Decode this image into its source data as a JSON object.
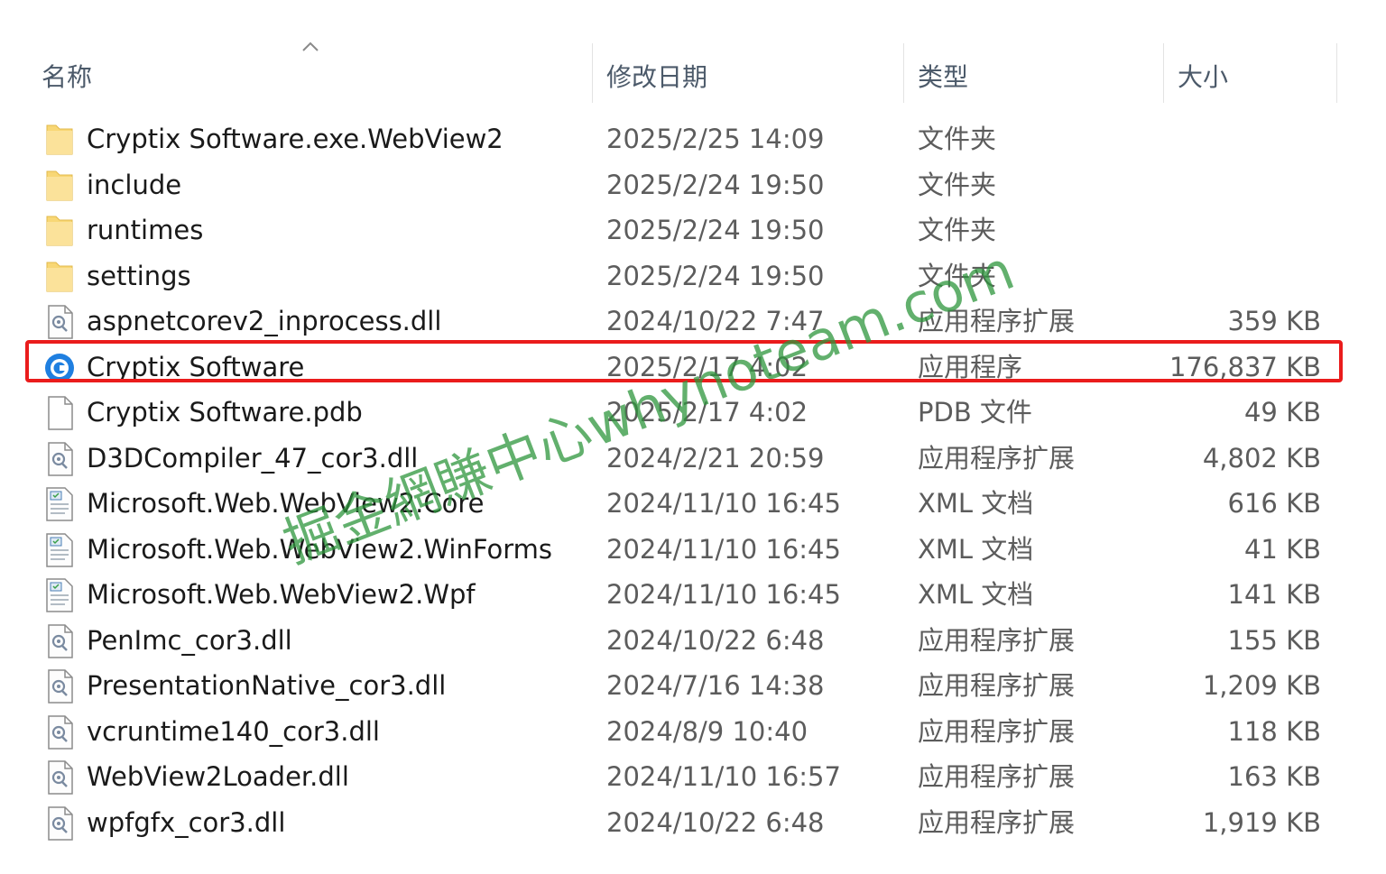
{
  "header": {
    "col_name": "名称",
    "col_date": "修改日期",
    "col_type": "类型",
    "col_size": "大小"
  },
  "files": [
    {
      "name": "Cryptix Software.exe.WebView2",
      "date": "2025/2/25 14:09",
      "type": "文件夹",
      "size": "",
      "icon": "folder-icon"
    },
    {
      "name": "include",
      "date": "2025/2/24 19:50",
      "type": "文件夹",
      "size": "",
      "icon": "folder-icon"
    },
    {
      "name": "runtimes",
      "date": "2025/2/24 19:50",
      "type": "文件夹",
      "size": "",
      "icon": "folder-icon"
    },
    {
      "name": "settings",
      "date": "2025/2/24 19:50",
      "type": "文件夹",
      "size": "",
      "icon": "folder-icon"
    },
    {
      "name": "aspnetcorev2_inprocess.dll",
      "date": "2024/10/22 7:47",
      "type": "应用程序扩展",
      "size": "359 KB",
      "icon": "dll-file-icon"
    },
    {
      "name": "Cryptix Software",
      "date": "2025/2/17 4:02",
      "type": "应用程序",
      "size": "176,837 KB",
      "icon": "app-icon"
    },
    {
      "name": "Cryptix Software.pdb",
      "date": "2025/2/17 4:02",
      "type": "PDB 文件",
      "size": "49 KB",
      "icon": "blank-file-icon"
    },
    {
      "name": "D3DCompiler_47_cor3.dll",
      "date": "2024/2/21 20:59",
      "type": "应用程序扩展",
      "size": "4,802 KB",
      "icon": "dll-file-icon"
    },
    {
      "name": "Microsoft.Web.WebView2.Core",
      "date": "2024/11/10 16:45",
      "type": "XML 文档",
      "size": "616 KB",
      "icon": "xml-file-icon"
    },
    {
      "name": "Microsoft.Web.WebView2.WinForms",
      "date": "2024/11/10 16:45",
      "type": "XML 文档",
      "size": "41 KB",
      "icon": "xml-file-icon"
    },
    {
      "name": "Microsoft.Web.WebView2.Wpf",
      "date": "2024/11/10 16:45",
      "type": "XML 文档",
      "size": "141 KB",
      "icon": "xml-file-icon"
    },
    {
      "name": "PenImc_cor3.dll",
      "date": "2024/10/22 6:48",
      "type": "应用程序扩展",
      "size": "155 KB",
      "icon": "dll-file-icon"
    },
    {
      "name": "PresentationNative_cor3.dll",
      "date": "2024/7/16 14:38",
      "type": "应用程序扩展",
      "size": "1,209 KB",
      "icon": "dll-file-icon"
    },
    {
      "name": "vcruntime140_cor3.dll",
      "date": "2024/8/9 10:40",
      "type": "应用程序扩展",
      "size": "118 KB",
      "icon": "dll-file-icon"
    },
    {
      "name": "WebView2Loader.dll",
      "date": "2024/11/10 16:57",
      "type": "应用程序扩展",
      "size": "163 KB",
      "icon": "dll-file-icon"
    },
    {
      "name": "wpfgfx_cor3.dll",
      "date": "2024/10/22 6:48",
      "type": "应用程序扩展",
      "size": "1,919 KB",
      "icon": "dll-file-icon"
    }
  ],
  "watermark": "掘金網賺中心whynoteam.com",
  "colors": {
    "highlight": "#ea1c1c",
    "watermark": "#2e963c",
    "folder": "#f8d775",
    "app_icon": "#1f7fe0"
  }
}
